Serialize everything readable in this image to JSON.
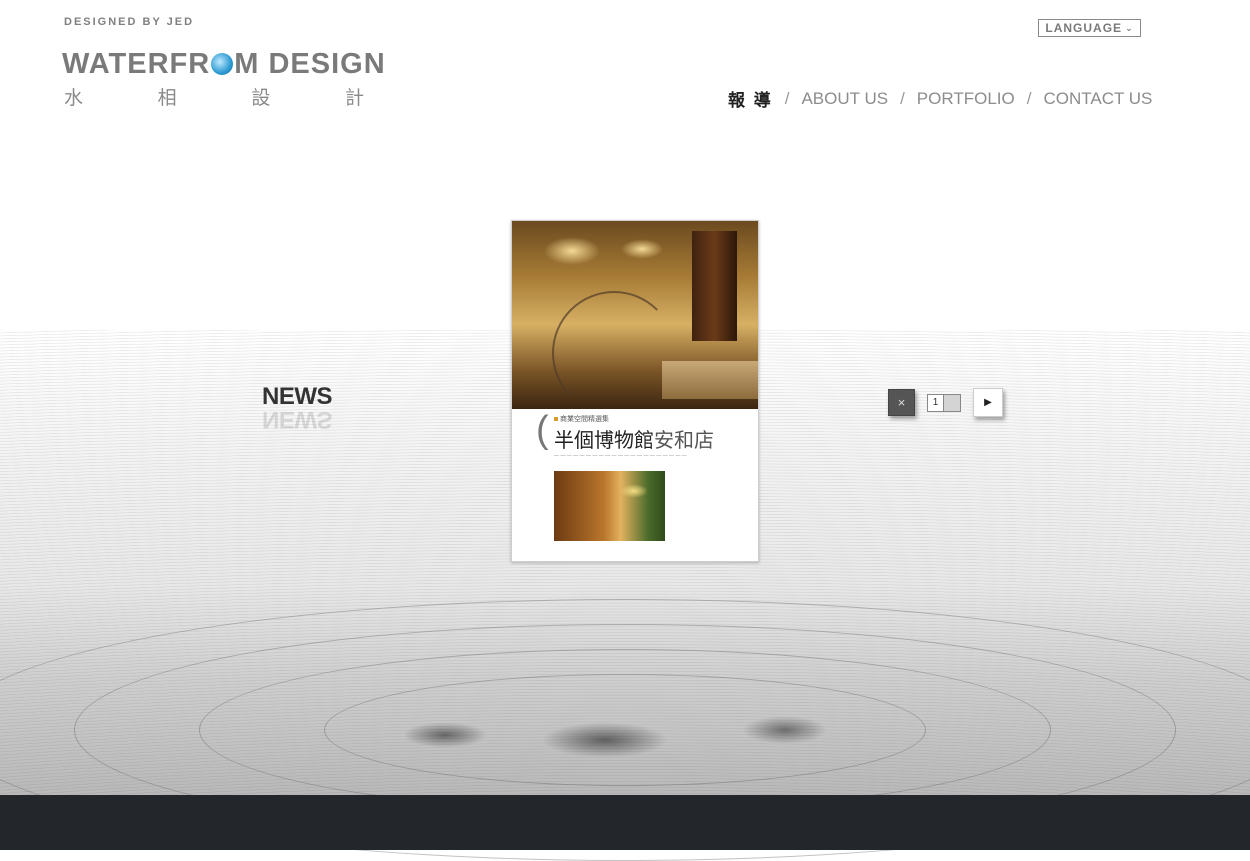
{
  "header": {
    "designed_by": "DESIGNED BY JED",
    "logo_en_part1": "WATERFR",
    "logo_en_part2": "M DESIGN",
    "logo_zh": [
      "水",
      "相",
      "設",
      "計"
    ],
    "language_label": "LANGUAGE"
  },
  "nav": {
    "items": [
      {
        "label": "報 導",
        "active": true
      },
      {
        "label": "ABOUT US",
        "active": false
      },
      {
        "label": "PORTFOLIO",
        "active": false
      },
      {
        "label": "CONTACT US",
        "active": false
      }
    ],
    "separator": "/"
  },
  "main": {
    "section_title": "NEWS",
    "magazine": {
      "kicker": "商業空間精選集",
      "title_bold": "半個博物館",
      "title_light": "安和店"
    },
    "pager": {
      "close_symbol": "×",
      "current_page": "1",
      "next_symbol": "▶"
    }
  },
  "colors": {
    "footer": "#23262b",
    "nav_active": "#222222",
    "nav_inactive": "#8c8c8c"
  }
}
